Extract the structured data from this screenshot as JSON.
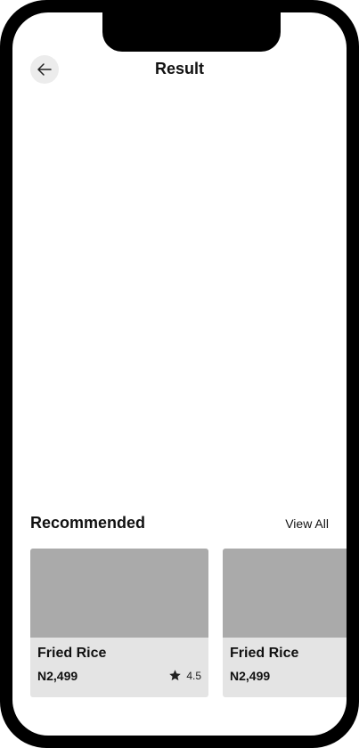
{
  "header": {
    "back_icon": "arrow-left-icon",
    "title": "Result"
  },
  "recommended": {
    "title": "Recommended",
    "view_all_label": "View All",
    "cards": [
      {
        "name": "Fried Rice",
        "price": "N2,499",
        "rating": "4.5",
        "rating_icon": "star-icon"
      },
      {
        "name": "Fried Rice",
        "price": "N2,499"
      }
    ]
  },
  "colors": {
    "frame": "#000000",
    "background": "#ffffff",
    "image_placeholder": "#aaaaaa",
    "card_background": "#e4e4e4",
    "back_button_bg": "#ececec"
  }
}
